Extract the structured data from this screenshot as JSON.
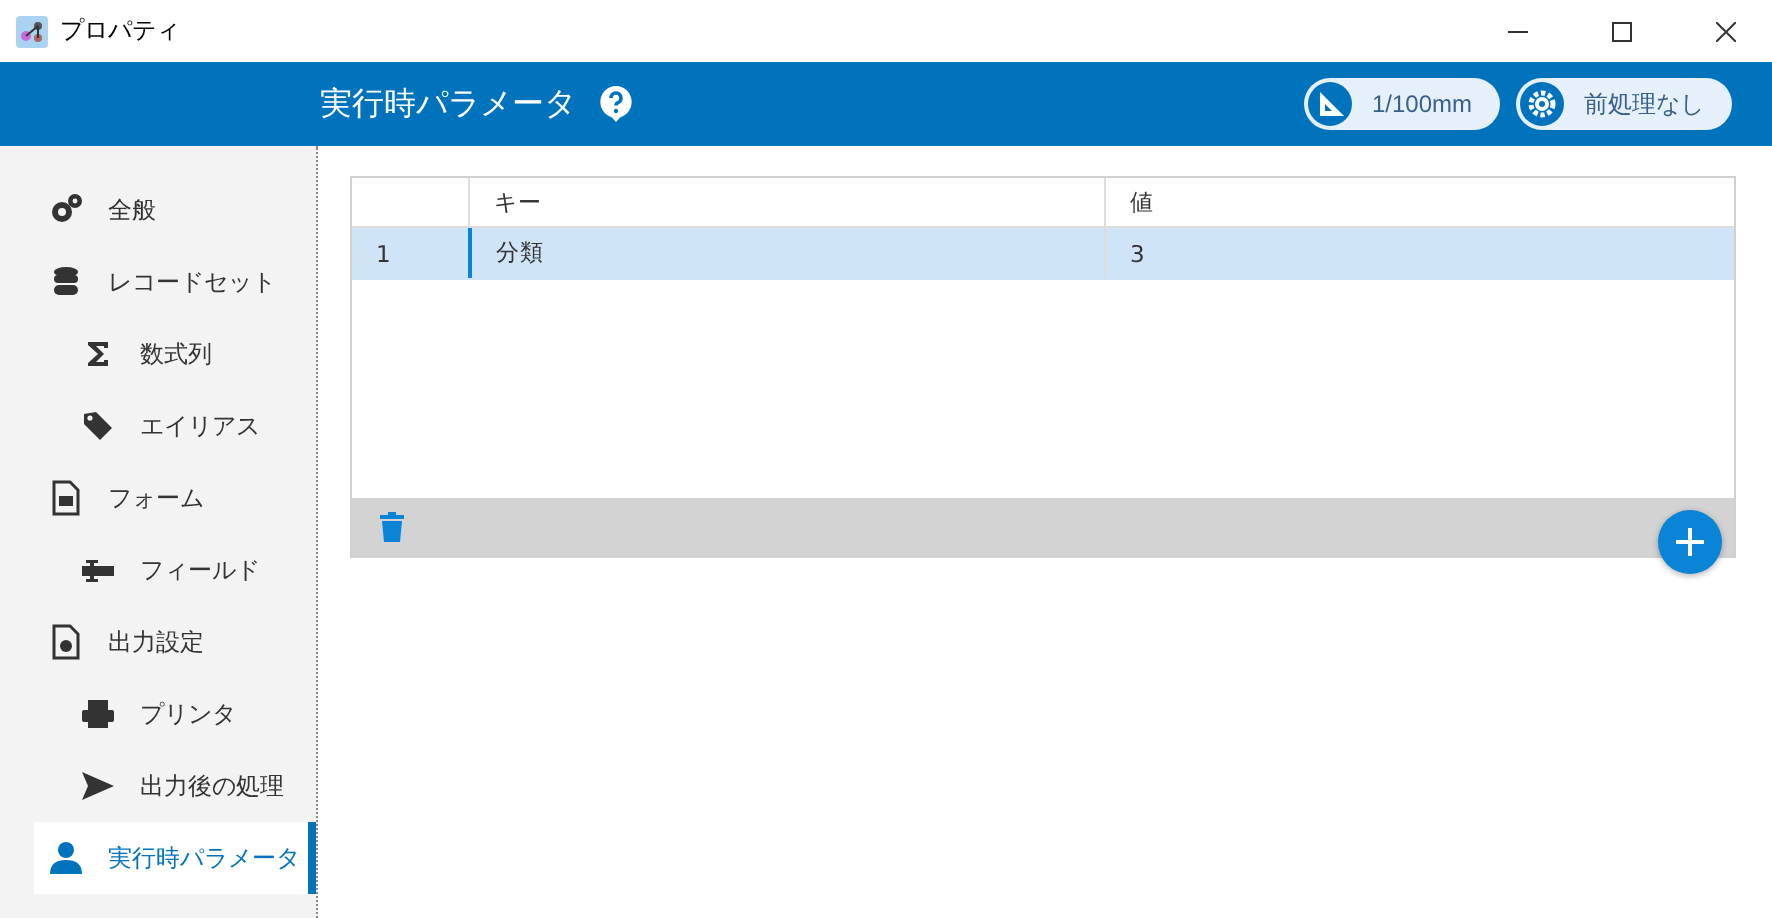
{
  "window": {
    "title": "プロパティ"
  },
  "header": {
    "title": "実行時パラメータ",
    "scale": "1/100mm",
    "preprocess": "前処理なし"
  },
  "sidebar": {
    "items": [
      {
        "label": "全般",
        "kind": "general",
        "selected": false
      },
      {
        "label": "レコードセット",
        "kind": "recordset",
        "selected": false,
        "children": [
          {
            "label": "数式列",
            "kind": "formula",
            "selected": false
          },
          {
            "label": "エイリアス",
            "kind": "alias",
            "selected": false
          }
        ]
      },
      {
        "label": "フォーム",
        "kind": "form",
        "selected": false,
        "children": [
          {
            "label": "フィールド",
            "kind": "field",
            "selected": false
          }
        ]
      },
      {
        "label": "出力設定",
        "kind": "output",
        "selected": false,
        "children": [
          {
            "label": "プリンタ",
            "kind": "printer",
            "selected": false
          },
          {
            "label": "出力後の処理",
            "kind": "post",
            "selected": false
          }
        ]
      },
      {
        "label": "実行時パラメータ",
        "kind": "param",
        "selected": true
      }
    ]
  },
  "table": {
    "columns": [
      "キー",
      "値"
    ],
    "rows": [
      {
        "number": "1",
        "cells": [
          "分類",
          "3"
        ],
        "selected": true
      }
    ]
  }
}
